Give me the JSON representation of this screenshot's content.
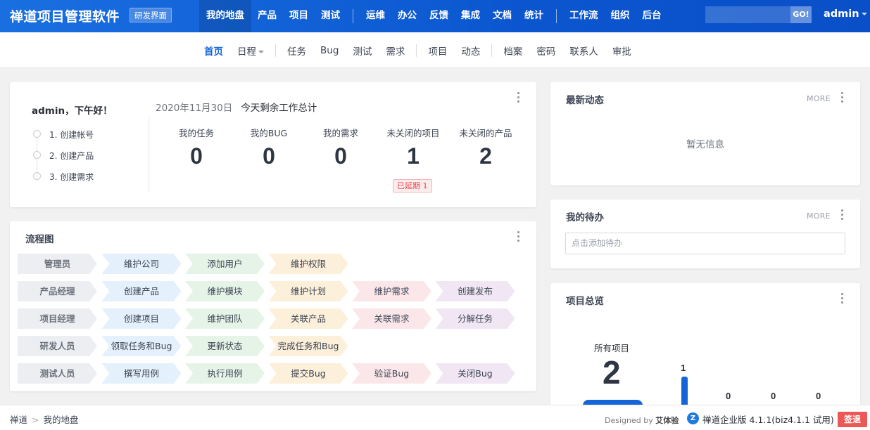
{
  "header": {
    "brand": "禅道项目管理软件",
    "badge": "研发界面",
    "nav_groups": [
      [
        "我的地盘",
        "产品",
        "项目",
        "测试"
      ],
      [
        "运维",
        "办公",
        "反馈",
        "集成",
        "文档",
        "统计"
      ],
      [
        "工作流",
        "组织",
        "后台"
      ]
    ],
    "active_nav": "我的地盘",
    "search_go": "GO!",
    "user": "admin"
  },
  "subnav": {
    "groups": [
      [
        "首页",
        "日程"
      ],
      [
        "任务",
        "Bug",
        "测试",
        "需求"
      ],
      [
        "项目",
        "动态"
      ],
      [
        "档案",
        "密码",
        "联系人",
        "审批"
      ]
    ],
    "active": "首页",
    "dropdown_item": "日程"
  },
  "welcome": {
    "greeting": "admin，下午好！",
    "steps": [
      "1. 创建帐号",
      "2. 创建产品",
      "3. 创建需求"
    ],
    "date": "2020年11月30日",
    "summary_title": "今天剩余工作总计",
    "stats": [
      {
        "label": "我的任务",
        "value": "0"
      },
      {
        "label": "我的BUG",
        "value": "0"
      },
      {
        "label": "我的需求",
        "value": "0"
      },
      {
        "label": "未关闭的项目",
        "value": "1"
      },
      {
        "label": "未关闭的产品",
        "value": "2"
      }
    ],
    "delay_badge": "已延期 1"
  },
  "flowchart": {
    "title": "流程图",
    "rows": [
      {
        "role": "管理员",
        "steps": [
          "维护公司",
          "添加用户",
          "维护权限"
        ]
      },
      {
        "role": "产品经理",
        "steps": [
          "创建产品",
          "维护模块",
          "维护计划",
          "维护需求",
          "创建发布"
        ]
      },
      {
        "role": "项目经理",
        "steps": [
          "创建项目",
          "维护团队",
          "关联产品",
          "关联需求",
          "分解任务"
        ]
      },
      {
        "role": "研发人员",
        "steps": [
          "领取任务和Bug",
          "更新状态",
          "完成任务和Bug"
        ]
      },
      {
        "role": "测试人员",
        "steps": [
          "撰写用例",
          "执行用例",
          "提交Bug",
          "验证Bug",
          "关闭Bug"
        ]
      }
    ],
    "step_colors": [
      "#e4f0fb",
      "#e6f4e8",
      "#fdf0da",
      "#fbe7ea",
      "#f1e6f4"
    ]
  },
  "dynamics": {
    "title": "最新动态",
    "more": "MORE",
    "empty": "暂无信息"
  },
  "todo": {
    "title": "我的待办",
    "more": "MORE",
    "placeholder": "点击添加待办"
  },
  "project_overview": {
    "title": "项目总览",
    "total_label": "所有项目",
    "total": "2",
    "bar_values": [
      "1",
      "0",
      "0",
      "0"
    ]
  },
  "footer": {
    "breadcrumb": [
      "禅道",
      "我的地盘"
    ],
    "designed_prefix": "Designed by",
    "designer": "艾体验",
    "version": "禅道企业版 4.1.1(biz4.1.1 试用)",
    "signout": "签退"
  },
  "colors": {
    "accent": "#1565d8",
    "header_gradient_start": "#1a6fe0",
    "header_gradient_end": "#0a4fc8",
    "danger": "#ec5858"
  }
}
